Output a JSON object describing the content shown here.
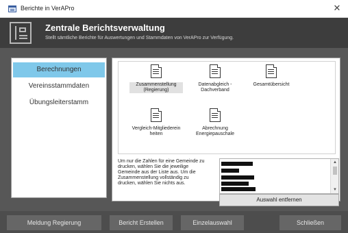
{
  "window": {
    "title": "Berichte in VerAPro",
    "close_glyph": "✕"
  },
  "header": {
    "title": "Zentrale Berichtsverwaltung",
    "subtitle": "Stellt sämtliche Berichte für Auswertungen und Stammdaten von VerAPro zur Verfügung."
  },
  "sidebar": {
    "items": [
      {
        "label": "Berechnungen",
        "active": true
      },
      {
        "label": "Vereinsstammdaten",
        "active": false
      },
      {
        "label": "Übungsleiterstamm",
        "active": false
      }
    ]
  },
  "reports": [
    {
      "label_line1": "Zusammenstellung",
      "label_line2": "(Regierung)",
      "selected": true
    },
    {
      "label_line1": "Datenabgleich -",
      "label_line2": "Dachverband",
      "selected": false
    },
    {
      "label_line1": "Gesamtübersicht",
      "label_line2": "",
      "selected": false
    },
    {
      "label_line1": "Vergleich-Mitgliederein",
      "label_line2": "heiten",
      "selected": false
    },
    {
      "label_line1": "Abrechnung",
      "label_line2": "Energiepauschale",
      "selected": false
    }
  ],
  "hint": {
    "lines": [
      "Um nur die Zahlen für eine Gemeinde zu",
      "drucken, wählen Sie die jeweilige",
      "Gemeinde aus der Liste aus. Um die",
      "Zusammenstellung vollständig zu",
      "drucken, wählen Sie nichts aus."
    ]
  },
  "scrollbar": {
    "up_glyph": "▲",
    "down_glyph": "▼"
  },
  "clear_button": {
    "label": "Auswahl entfernen"
  },
  "footer": {
    "buttons": [
      {
        "label": "Meldung Regierung"
      },
      {
        "label": "Bericht Erstellen"
      },
      {
        "label": "Einzelauswahl"
      },
      {
        "label": "Schließen"
      }
    ]
  },
  "colors": {
    "header_bg": "#3d3d3d",
    "main_bg": "#575757",
    "footer_bg": "#4d4d4d",
    "active_tab": "#7fc8ea",
    "footer_button": "#666666"
  }
}
